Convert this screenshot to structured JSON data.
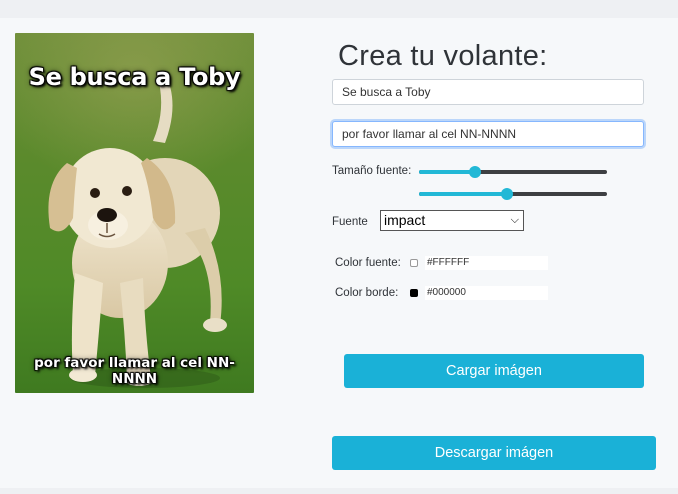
{
  "meme": {
    "top_text": "Se busca a Toby",
    "bottom_text": "por favor llamar al cel NN-NNNN"
  },
  "form": {
    "title": "Crea tu volante:",
    "top_text_value": "Se busca a Toby",
    "bottom_text_value": "por favor llamar al cel NN-NNNN",
    "font_size_label": "Tamaño fuente:",
    "font_size_top_level": 0.3,
    "font_size_bottom_level": 0.47,
    "font_label": "Fuente",
    "font_selected": "impact",
    "font_color_label": "Color fuente:",
    "font_color_value": "#FFFFFF",
    "border_color_label": "Color borde:",
    "border_color_value": "#000000",
    "load_button": "Cargar imágen",
    "download_button": "Descargar imágen"
  },
  "colors": {
    "accent": "#1ab1d7",
    "slider_accent": "#22b8d6",
    "font_swatch": "#FFFFFF",
    "border_swatch": "#000000"
  },
  "icons": {
    "select_caret": "chevron-down-icon"
  }
}
